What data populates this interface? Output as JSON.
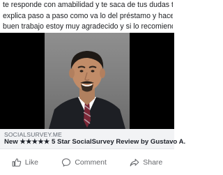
{
  "post": {
    "text_lines": [
      "te responde con amabilidad y te saca de tus dudas te",
      "explica paso a paso como va lo del préstamo y hace un",
      "buen trabajo estoy muy agradecido y si lo recomiendo"
    ]
  },
  "link_preview": {
    "domain": "SOCIALSURVEY.ME",
    "title": "New ★★★★★ 5 Star SocialSurvey Review by Gustavo A."
  },
  "actions": {
    "like": "Like",
    "comment": "Comment",
    "share": "Share"
  },
  "colors": {
    "media_bg": "#000000",
    "link_meta_bg": "#f2f3f5",
    "action_text": "#65676b"
  }
}
